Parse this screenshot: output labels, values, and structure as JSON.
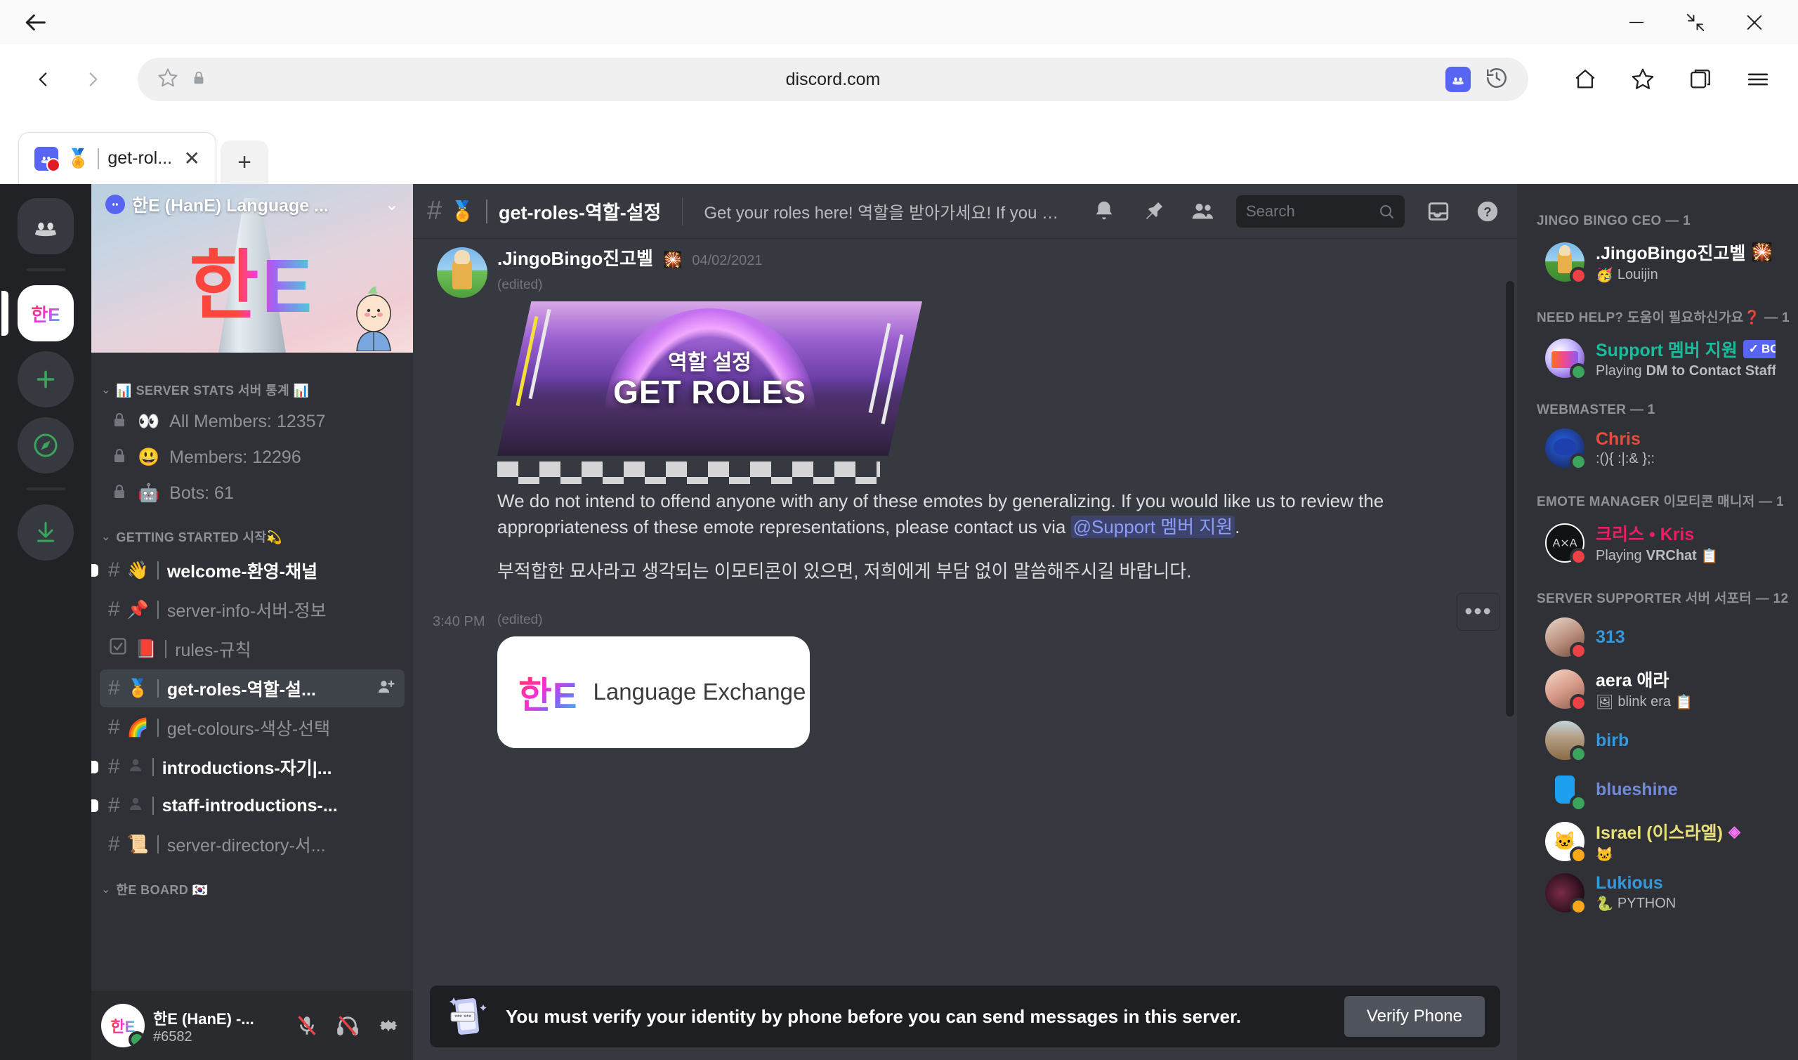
{
  "browser": {
    "back_icon": "arrow-left",
    "url": "discord.com",
    "tab": {
      "favicon": "discord-favicon",
      "emoji": "🏅",
      "title": "get-rol...",
      "close": "✕"
    },
    "new_tab": "+",
    "window": {
      "minimize": "—",
      "restore": "⤡",
      "close": "✕"
    },
    "toolbar_icons": [
      "star-icon",
      "lock-icon",
      "discord-extension-icon",
      "history-icon",
      "home-icon",
      "favorites-icon",
      "collections-icon",
      "menu-icon"
    ]
  },
  "guild_rail": {
    "home": "discord-home",
    "active_guild": "한E",
    "add_server": "+",
    "explore": "compass",
    "download": "download"
  },
  "server": {
    "name": "한E (HanE) Language ...",
    "verified": true,
    "chevron": "⌄"
  },
  "categories": [
    {
      "name": "📊 SERVER STATS 서버 통계 📊",
      "channels": [
        {
          "icon": "lock-icon",
          "emoji": "👀",
          "name": "All Members: 12357",
          "type": "stat"
        },
        {
          "icon": "lock-icon",
          "emoji": "😃",
          "name": "Members: 12296",
          "type": "stat"
        },
        {
          "icon": "lock-icon",
          "emoji": "🤖",
          "name": "Bots: 61",
          "type": "stat"
        }
      ]
    },
    {
      "name": "GETTING STARTED 시작💫",
      "channels": [
        {
          "hash": "#",
          "emoji": "👋",
          "name": "welcome-환영-채널",
          "unread": true,
          "active": false
        },
        {
          "hash": "#",
          "emoji": "📌",
          "name": "server-info-서버-정보",
          "unread": false,
          "active": false
        },
        {
          "hash": "☑",
          "emoji": "📕",
          "name": "rules-규칙",
          "unread": false,
          "active": false
        },
        {
          "hash": "#",
          "emoji": "🏅",
          "name": "get-roles-역할-설...",
          "unread": false,
          "active": true,
          "invite": true
        },
        {
          "hash": "#",
          "emoji": "🌈",
          "name": "get-colours-색상-선택",
          "unread": false,
          "active": false
        },
        {
          "hash": "#",
          "emoji": "👤",
          "name": "introductions-자기|...",
          "unread": true,
          "active": false
        },
        {
          "hash": "#",
          "emoji": "👤",
          "name": "staff-introductions-...",
          "unread": true,
          "active": false
        },
        {
          "hash": "#",
          "emoji": "📜",
          "name": "server-directory-서...",
          "unread": false,
          "active": false
        }
      ]
    },
    {
      "name": "한E BOARD 🇰🇷",
      "channels": []
    }
  ],
  "user_panel": {
    "avatar_text": "한E",
    "name": "한E (HanE) -...",
    "tag": "#6582",
    "mute_icon": "mic-muted-icon",
    "deafen_icon": "headphones-muted-icon",
    "settings_icon": "gear-icon"
  },
  "chat_header": {
    "hash": "#",
    "emoji": "🏅",
    "channel": "get-roles-역할-설정",
    "topic": "Get your roles here! 역할을 받아가세요! If you are unsure of what 'roles' are, ple...",
    "icons": [
      "bell-icon",
      "pin-icon",
      "members-icon",
      "inbox-icon",
      "help-icon"
    ]
  },
  "search": {
    "placeholder": "Search",
    "icon": "search-icon"
  },
  "messages": [
    {
      "author": ".JingoBingo진고벨",
      "author_emoji": "🎇",
      "timestamp": "04/02/2021",
      "edited": "(edited)",
      "banner": {
        "title_kr": "역할 설정",
        "title_en": "GET ROLES"
      },
      "text_en": "We do not intend to offend anyone with any of these emotes by generalizing. If you would like us to review the appropriateness of these emote representations, please contact us via ",
      "mention": "@Support 멤버 지원",
      "text_after": ".",
      "text_kr": "부적합한 묘사라고 생각되는 이모티콘이 있으면, 저희에게 부담 없이 말씀해주시길 바랍니다."
    },
    {
      "time": "3:40 PM",
      "edited": "(edited)",
      "embed_logo": "한E",
      "embed_title": "Language Exchange"
    }
  ],
  "verify": {
    "icon": "phone-verify-icon",
    "message": "You must verify your identity by phone before you can send messages in this server.",
    "button": "Verify Phone"
  },
  "member_groups": [
    {
      "title": "JINGO BINGO CEO — 1",
      "members": [
        {
          "name": ".JingoBingo진고벨",
          "name_emoji": "🎇",
          "boost": true,
          "status": "dnd",
          "sub_emoji": "🥳",
          "sub": "Louijin",
          "color": "#ffffff",
          "avatar": "alpaca"
        }
      ]
    },
    {
      "title": "NEED HELP? 도움이 필요하신가요❓ — 1",
      "members": [
        {
          "name": "Support 멤버 지원",
          "bot": "BOT",
          "status": "online",
          "sub_prefix": "Playing ",
          "sub": "DM to Contact Staff | ...",
          "color": "#1abc9c",
          "avatar": "envelope"
        }
      ]
    },
    {
      "title": "WEBMASTER — 1",
      "members": [
        {
          "name": "Chris",
          "status": "online",
          "sub": ":(){ :|:& };:",
          "color": "#e74c3c",
          "avatar": "blue"
        }
      ]
    },
    {
      "title": "EMOTE MANAGER 이모티콘 매니저 — 1",
      "members": [
        {
          "name": "크리스 • Kris",
          "status": "dnd",
          "sub_prefix": "Playing ",
          "sub": "VRChat",
          "sub_icon": "📋",
          "color": "#e91e63",
          "avatar": "kris"
        }
      ]
    },
    {
      "title": "SERVER SUPPORTER 서버 서포터 — 12",
      "members": [
        {
          "name": "313",
          "status": "dnd",
          "sub": "",
          "color": "#3498db",
          "avatar": "photo1"
        },
        {
          "name": "aera 애라",
          "status": "dnd",
          "sub": "blink era",
          "sub_emoji": "🖼",
          "sub_icon": "📋",
          "color": "#ffffff",
          "avatar": "photo2"
        },
        {
          "name": "birb",
          "status": "online",
          "sub": "",
          "color": "#3498db",
          "avatar": "alpaca2"
        },
        {
          "name": "blueshine",
          "status": "online",
          "sub": "",
          "color": "#7289da",
          "avatar": "blueguy"
        },
        {
          "name": "Israel (이스라엘)",
          "boost": true,
          "status": "idle",
          "sub_emoji": "🐱",
          "sub": "",
          "color": "#e8e07a",
          "avatar": "cat"
        },
        {
          "name": "Lukious",
          "status": "idle",
          "sub_emoji": "🐍",
          "sub": "PYTHON",
          "color": "#3498db",
          "avatar": "dark"
        }
      ]
    }
  ],
  "colors": {
    "discord_blurple": "#5865F2",
    "sidebar_bg": "#2f3136",
    "chat_bg": "#36393f",
    "rail_bg": "#202225",
    "online": "#3ba55d",
    "dnd": "#ed4245",
    "idle": "#faa81a"
  }
}
